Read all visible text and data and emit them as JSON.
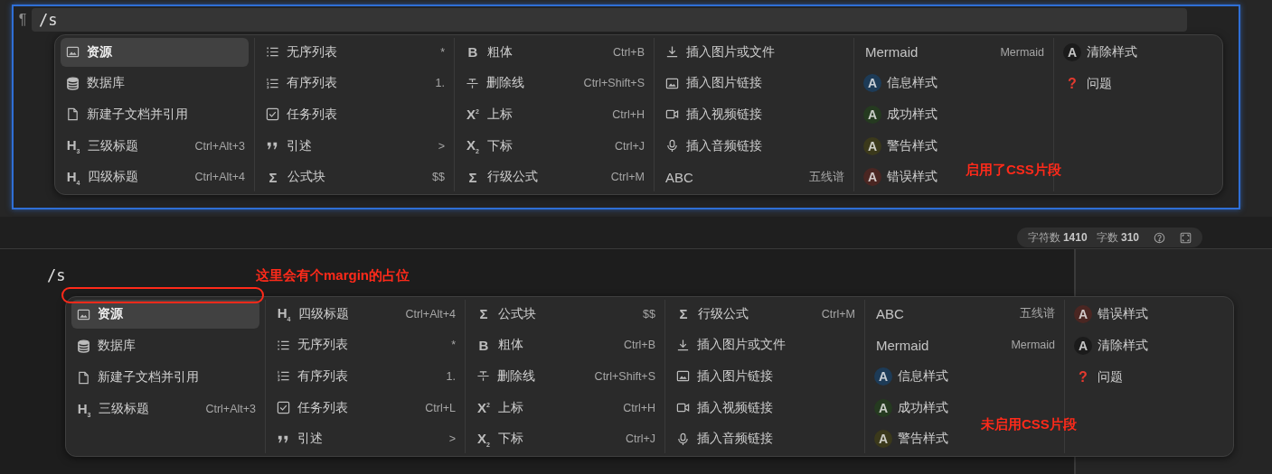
{
  "top_editor": {
    "marker": "¶",
    "input": "/s",
    "note": "启用了CSS片段",
    "menu": {
      "columns": [
        [
          {
            "kind": "image",
            "label": "资源",
            "selected": true
          },
          {
            "kind": "database",
            "label": "数据库",
            "selected": false
          },
          {
            "kind": "file",
            "label": "新建子文档并引用",
            "selected": false
          },
          {
            "kind": "glyph",
            "glyph": "H$_{3}$",
            "label": "三级标题",
            "hint": "Ctrl+Alt+3",
            "selected": false
          },
          {
            "kind": "glyph",
            "glyph": "H$_{4}$",
            "label": "四级标题",
            "hint": "Ctrl+Alt+4",
            "selected": false
          }
        ],
        [
          {
            "kind": "list-ul",
            "label": "无序列表",
            "hint": "*",
            "selected": false
          },
          {
            "kind": "list-ol",
            "label": "有序列表",
            "hint": "1.",
            "selected": false
          },
          {
            "kind": "task",
            "label": "任务列表",
            "selected": false
          },
          {
            "kind": "quote",
            "label": "引述",
            "hint": ">",
            "selected": false
          },
          {
            "kind": "glyph",
            "glyph": "Σ",
            "label": "公式块",
            "hint": "$$",
            "selected": false
          }
        ],
        [
          {
            "kind": "glyph",
            "glyph": "B",
            "label": "粗体",
            "hint": "Ctrl+B",
            "selected": false
          },
          {
            "kind": "strike",
            "label": "删除线",
            "hint": "Ctrl+Shift+S",
            "selected": false
          },
          {
            "kind": "glyph",
            "glyph": "X$^{2}$",
            "label": "上标",
            "hint": "Ctrl+H",
            "selected": false
          },
          {
            "kind": "glyph",
            "glyph": "X$_{2}$",
            "label": "下标",
            "hint": "Ctrl+J",
            "selected": false
          },
          {
            "kind": "glyph",
            "glyph": "Σ",
            "label": "行级公式",
            "hint": "Ctrl+M",
            "selected": false
          }
        ],
        [
          {
            "kind": "download",
            "label": "插入图片或文件",
            "selected": false
          },
          {
            "kind": "image",
            "label": "插入图片链接",
            "selected": false
          },
          {
            "kind": "video",
            "label": "插入视频链接",
            "selected": false
          },
          {
            "kind": "mic",
            "label": "插入音频链接",
            "selected": false
          },
          {
            "kind": "plain",
            "label": "ABC",
            "hint": "五线谱",
            "selected": false
          }
        ],
        [
          {
            "kind": "plain",
            "label": "Mermaid",
            "hint": "Mermaid",
            "selected": false
          },
          {
            "kind": "badge",
            "glyph": "A",
            "color": "#1d3b57",
            "label": "信息样式",
            "selected": false
          },
          {
            "kind": "badge",
            "glyph": "A",
            "color": "#253a20",
            "label": "成功样式",
            "selected": false
          },
          {
            "kind": "badge",
            "glyph": "A",
            "color": "#3b391b",
            "label": "警告样式",
            "selected": false
          },
          {
            "kind": "badge",
            "glyph": "A",
            "color": "#4a2622",
            "label": "错误样式",
            "selected": false
          }
        ],
        [
          {
            "kind": "badge",
            "glyph": "A",
            "color": "#1b1b1b",
            "label": "清除样式",
            "selected": false
          },
          {
            "kind": "question",
            "glyph": "?",
            "label": "问题",
            "selected": false
          }
        ]
      ]
    }
  },
  "status": {
    "chars_label": "字符数",
    "chars": "1410",
    "words_label": "字数",
    "words": "310"
  },
  "bottom_editor": {
    "input": "/s",
    "margin_note": "这里会有个margin的占位",
    "note": "未启用CSS片段",
    "menu": {
      "columns": [
        [
          {
            "kind": "image",
            "label": "资源",
            "selected": true
          },
          {
            "kind": "database",
            "label": "数据库",
            "selected": false
          },
          {
            "kind": "file",
            "label": "新建子文档并引用",
            "selected": false
          },
          {
            "kind": "glyph",
            "glyph": "H$_{3}$",
            "label": "三级标题",
            "hint": "Ctrl+Alt+3",
            "selected": false
          }
        ],
        [
          {
            "kind": "glyph",
            "glyph": "H$_{4}$",
            "label": "四级标题",
            "hint": "Ctrl+Alt+4",
            "selected": false
          },
          {
            "kind": "list-ul",
            "label": "无序列表",
            "hint": "*",
            "selected": false
          },
          {
            "kind": "list-ol",
            "label": "有序列表",
            "hint": "1.",
            "selected": false
          },
          {
            "kind": "task",
            "label": "任务列表",
            "hint": "Ctrl+L",
            "selected": false
          },
          {
            "kind": "quote",
            "label": "引述",
            "hint": ">",
            "selected": false
          }
        ],
        [
          {
            "kind": "glyph",
            "glyph": "Σ",
            "label": "公式块",
            "hint": "$$",
            "selected": false
          },
          {
            "kind": "glyph",
            "glyph": "B",
            "label": "粗体",
            "hint": "Ctrl+B",
            "selected": false
          },
          {
            "kind": "strike",
            "label": "删除线",
            "hint": "Ctrl+Shift+S",
            "selected": false
          },
          {
            "kind": "glyph",
            "glyph": "X$^{2}$",
            "label": "上标",
            "hint": "Ctrl+H",
            "selected": false
          },
          {
            "kind": "glyph",
            "glyph": "X$_{2}$",
            "label": "下标",
            "hint": "Ctrl+J",
            "selected": false
          }
        ],
        [
          {
            "kind": "glyph",
            "glyph": "Σ",
            "label": "行级公式",
            "hint": "Ctrl+M",
            "selected": false
          },
          {
            "kind": "download",
            "label": "插入图片或文件",
            "selected": false
          },
          {
            "kind": "image",
            "label": "插入图片链接",
            "selected": false
          },
          {
            "kind": "video",
            "label": "插入视频链接",
            "selected": false
          },
          {
            "kind": "mic",
            "label": "插入音频链接",
            "selected": false
          }
        ],
        [
          {
            "kind": "plain",
            "label": "ABC",
            "hint": "五线谱",
            "selected": false
          },
          {
            "kind": "plain",
            "label": "Mermaid",
            "hint": "Mermaid",
            "selected": false
          },
          {
            "kind": "badge",
            "glyph": "A",
            "color": "#1d3b57",
            "label": "信息样式",
            "selected": false
          },
          {
            "kind": "badge",
            "glyph": "A",
            "color": "#253a20",
            "label": "成功样式",
            "selected": false
          },
          {
            "kind": "badge",
            "glyph": "A",
            "color": "#3b391b",
            "label": "警告样式",
            "selected": false
          }
        ],
        [
          {
            "kind": "badge",
            "glyph": "A",
            "color": "#4a2622",
            "label": "错误样式",
            "selected": false
          },
          {
            "kind": "badge",
            "glyph": "A",
            "color": "#1b1b1b",
            "label": "清除样式",
            "selected": false
          },
          {
            "kind": "question",
            "glyph": "?",
            "label": "问题",
            "selected": false
          }
        ]
      ]
    }
  }
}
